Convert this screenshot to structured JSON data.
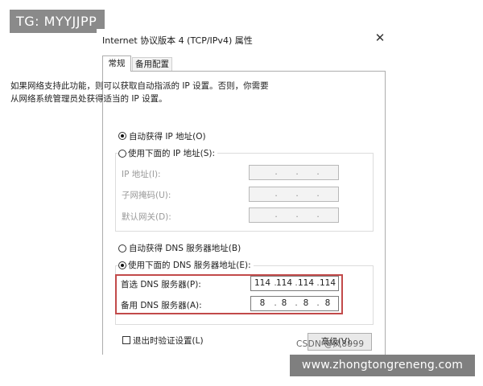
{
  "watermark_top": "TG: MYYJJPP",
  "dialog": {
    "title": "Internet 协议版本 4 (TCP/IPv4) 属性",
    "close_glyph": "✕",
    "tabs": [
      {
        "label": "常规",
        "active": true
      },
      {
        "label": "备用配置",
        "active": false
      }
    ],
    "description": "如果网络支持此功能，则可以获取自动指派的 IP 设置。否则，你需要从网络系统管理员处获得适当的 IP 设置。",
    "ip_auto_label": "自动获得 IP 地址(O)",
    "ip_manual_label": "使用下面的 IP 地址(S):",
    "ip_fields": [
      {
        "label": "IP 地址(I):"
      },
      {
        "label": "子网掩码(U):"
      },
      {
        "label": "默认网关(D):"
      }
    ],
    "dns_auto_label": "自动获得 DNS 服务器地址(B)",
    "dns_manual_label": "使用下面的 DNS 服务器地址(E):",
    "dns_preferred_label": "首选 DNS 服务器(P):",
    "dns_preferred_value": [
      "114",
      "114",
      "114",
      "114"
    ],
    "dns_alternate_label": "备用 DNS 服务器(A):",
    "dns_alternate_value": [
      "8",
      "8",
      "8",
      "8"
    ],
    "validate_label": "退出时验证设置(L)",
    "advanced_button": "高级(V)..."
  },
  "csdn_watermark": "CSDN @风8999",
  "footer_watermark": "www.zhongtongreneng.com",
  "accent_color": "#c24a4a"
}
